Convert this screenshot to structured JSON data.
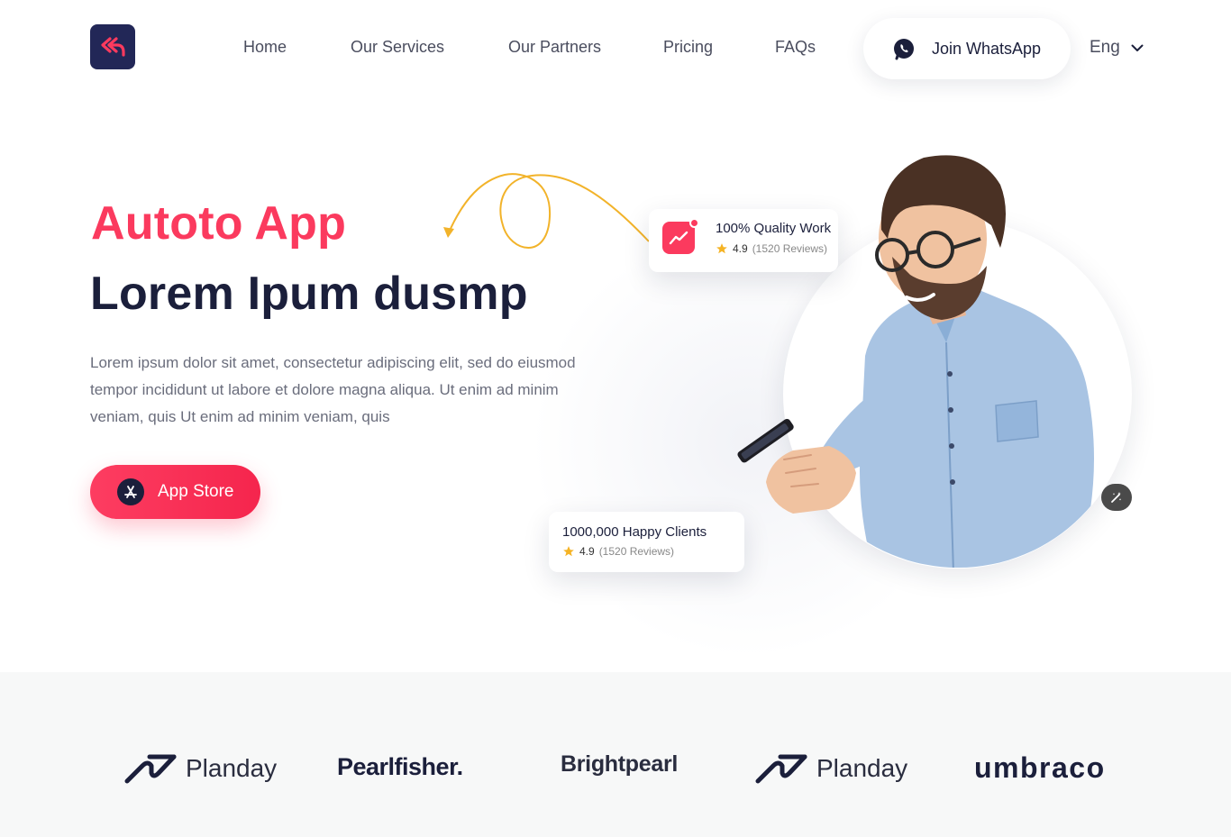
{
  "nav": {
    "logo_icon": "double-reply-arrow-icon",
    "links": [
      "Home",
      "Our Services",
      "Our Partners",
      "Pricing",
      "FAQs"
    ],
    "whatsapp_label": "Join WhatsApp",
    "language": "Eng"
  },
  "hero": {
    "kicker": "Autoto App",
    "title": "Lorem Ipum dusmp",
    "description": "Lorem ipsum dolor sit amet, consectetur adipiscing elit, sed do eiusmod tempor incididunt ut labore et dolore magna aliqua. Ut enim ad minim veniam, quis Ut enim ad minim veniam, quis",
    "cta_label": "App Store"
  },
  "cards": {
    "quality": {
      "title": "100% Quality Work",
      "rating": "4.9",
      "reviews": "(1520 Reviews)"
    },
    "clients": {
      "title": "1000,000 Happy Clients",
      "rating": "4.9",
      "reviews": "(1520 Reviews)"
    }
  },
  "partners": [
    "Planday",
    "Pearlfisher.",
    "Brightpearl",
    "Planday",
    "umbraco"
  ],
  "colors": {
    "accent": "#fb3a5e",
    "navy": "#1b1f3b",
    "logo_bg": "#222757",
    "star": "#f5b324",
    "squiggle": "#f2b32a"
  }
}
